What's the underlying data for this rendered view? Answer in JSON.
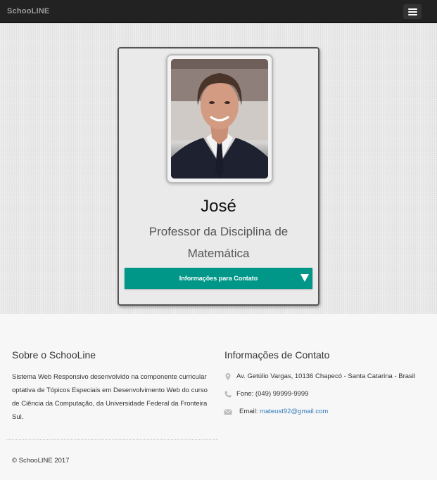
{
  "navbar": {
    "brand": "SchooLINE",
    "toggle_icon": "hamburger-menu-icon"
  },
  "profile": {
    "photo_alt": "photo of man in suit",
    "name": "José",
    "role": "Professor da Disciplina de Matemática",
    "contact_button_label": "Informações para Contato",
    "button_color": "#009688"
  },
  "footer": {
    "about_title": "Sobre o SchooLine",
    "about_text": "Sistema Web Responsivo desenvolvido na componente curricular optativa de Tópicos Especiais em Desenvolvimento Web do curso de Ciência da Computação, da Universidade Federal da Fronteira Sul.",
    "contact_title": "Informações de Contato",
    "address": "Av. Getúlio Vargas, 10136 Chapecó - Santa Catarina - Brasil",
    "phone": "Fone: (049) 99999-9999",
    "email_label": "Email:",
    "email": "mateust92@gmail.com",
    "copyright": "© SchooLINE 2017",
    "icons": [
      "map-marker-icon",
      "phone-icon",
      "envelope-icon"
    ]
  }
}
